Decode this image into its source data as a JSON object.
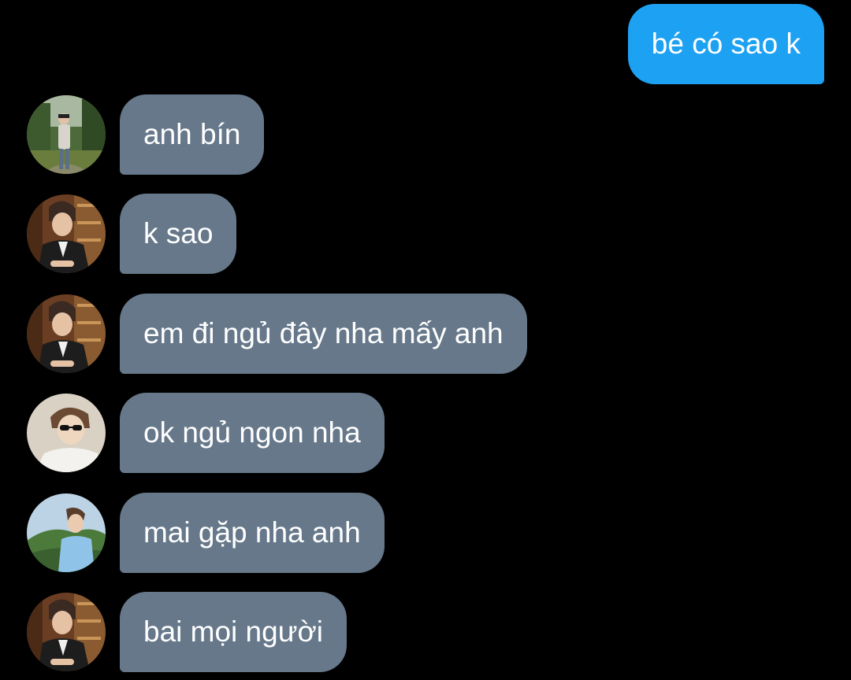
{
  "messages": [
    {
      "direction": "outgoing",
      "text": "bé có sao k"
    },
    {
      "direction": "incoming",
      "avatar": "avatar-park",
      "text": "anh bín"
    },
    {
      "direction": "incoming",
      "avatar": "avatar-bookshelf",
      "text": "k sao"
    },
    {
      "direction": "incoming",
      "avatar": "avatar-bookshelf",
      "text": "em đi ngủ đây nha mấy anh"
    },
    {
      "direction": "incoming",
      "avatar": "avatar-sunglasses",
      "text": "ok ngủ ngon nha"
    },
    {
      "direction": "incoming",
      "avatar": "avatar-mountain",
      "text": "mai gặp nha anh"
    },
    {
      "direction": "incoming",
      "avatar": "avatar-bookshelf",
      "text": "bai mọi người"
    }
  ],
  "colors": {
    "background": "#000000",
    "outgoing_bubble": "#1da1f2",
    "incoming_bubble": "#66788a",
    "text": "#ffffff"
  }
}
